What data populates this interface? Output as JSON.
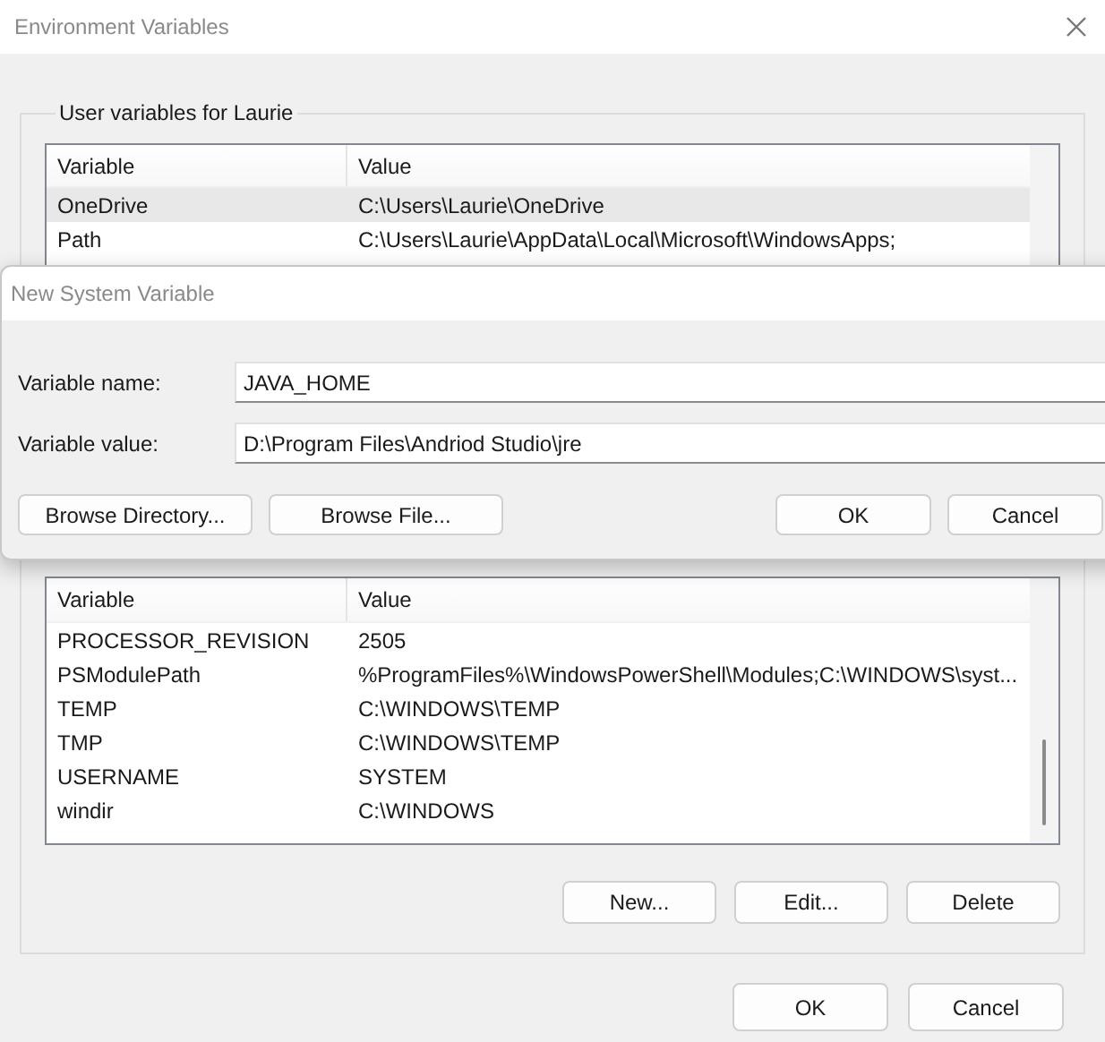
{
  "window": {
    "title": "Environment Variables"
  },
  "user_variables": {
    "legend": "User variables for Laurie",
    "columns": [
      "Variable",
      "Value"
    ],
    "rows": [
      {
        "variable": "OneDrive",
        "value": "C:\\Users\\Laurie\\OneDrive",
        "selected": true
      },
      {
        "variable": "Path",
        "value": "C:\\Users\\Laurie\\AppData\\Local\\Microsoft\\WindowsApps;",
        "selected": false
      }
    ]
  },
  "system_variables": {
    "columns": [
      "Variable",
      "Value"
    ],
    "rows": [
      {
        "variable": "PROCESSOR_REVISION",
        "value": "2505",
        "selected": false
      },
      {
        "variable": "PSModulePath",
        "value": "%ProgramFiles%\\WindowsPowerShell\\Modules;C:\\WINDOWS\\syst...",
        "selected": false
      },
      {
        "variable": "TEMP",
        "value": "C:\\WINDOWS\\TEMP",
        "selected": false
      },
      {
        "variable": "TMP",
        "value": "C:\\WINDOWS\\TEMP",
        "selected": false
      },
      {
        "variable": "USERNAME",
        "value": "SYSTEM",
        "selected": false
      },
      {
        "variable": "windir",
        "value": "C:\\WINDOWS",
        "selected": false
      }
    ],
    "buttons": [
      "New...",
      "Edit...",
      "Delete"
    ]
  },
  "buttons": [
    "OK",
    "Cancel"
  ],
  "dialog": {
    "title": "New System Variable",
    "fields": [
      {
        "label": "Variable name:",
        "value": "JAVA_HOME"
      },
      {
        "label": "Variable value:",
        "value": "D:\\Program Files\\Andriod Studio\\jre"
      }
    ],
    "left_buttons": [
      "Browse Directory...",
      "Browse File..."
    ],
    "right_buttons": [
      "OK",
      "Cancel"
    ]
  }
}
